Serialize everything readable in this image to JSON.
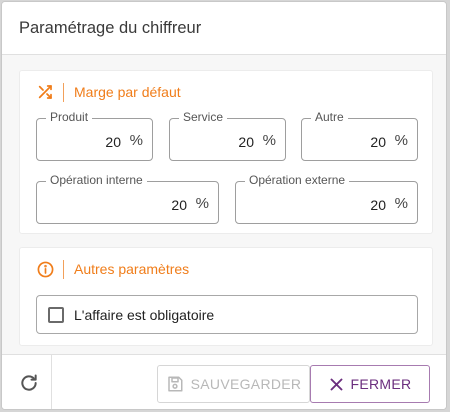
{
  "dialog": {
    "title": "Paramétrage du chiffreur"
  },
  "margin_section": {
    "title": "Marge par défaut",
    "icon": "shuffle-icon",
    "fields": [
      {
        "label": "Produit",
        "value": "20",
        "suffix": "%"
      },
      {
        "label": "Service",
        "value": "20",
        "suffix": "%"
      },
      {
        "label": "Autre",
        "value": "20",
        "suffix": "%"
      },
      {
        "label": "Opération interne",
        "value": "20",
        "suffix": "%"
      },
      {
        "label": "Opération externe",
        "value": "20",
        "suffix": "%"
      }
    ]
  },
  "other_section": {
    "title": "Autres paramètres",
    "icon": "info-icon",
    "checkbox": {
      "label": "L'affaire est obligatoire",
      "checked": false
    }
  },
  "footer": {
    "refresh_icon": "refresh-icon",
    "save_label": "SAUVEGARDER",
    "save_icon": "save-icon",
    "save_disabled": true,
    "close_label": "FERMER",
    "close_icon": "close-icon"
  },
  "colors": {
    "accent": "#f07d1a",
    "close_button": "#6b2e7e",
    "disabled": "#b8b8b8"
  }
}
